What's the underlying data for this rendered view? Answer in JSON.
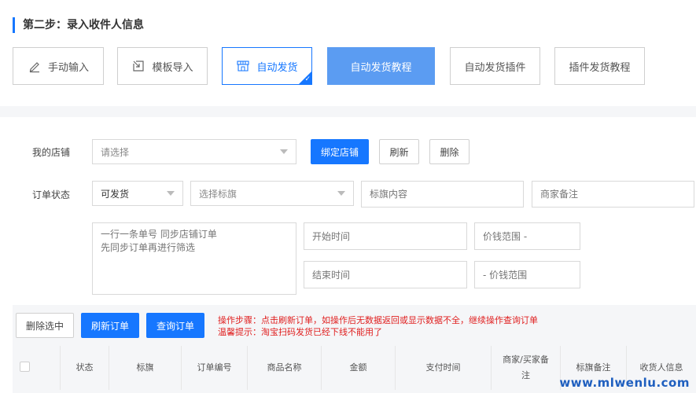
{
  "step": {
    "title": "第二步：录入收件人信息"
  },
  "methods": [
    {
      "label": "手动输入",
      "icon": "pencil-icon"
    },
    {
      "label": "模板导入",
      "icon": "import-icon"
    },
    {
      "label": "自动发货",
      "icon": "store-icon",
      "selected": true
    },
    {
      "label": "自动发货教程",
      "highlight": true
    },
    {
      "label": "自动发货插件"
    },
    {
      "label": "插件发货教程"
    }
  ],
  "shop": {
    "label": "我的店铺",
    "placeholder": "请选择",
    "bind_btn": "绑定店铺",
    "refresh_btn": "刷新",
    "delete_btn": "删除"
  },
  "order": {
    "label": "订单状态",
    "status_value": "可发货",
    "flag_placeholder": "选择标旗",
    "flag_content_placeholder": "标旗内容",
    "merchant_note_placeholder": "商家备注",
    "order_numbers_placeholder": "一行一条单号 同步店铺订单\n先同步订单再进行筛选",
    "start_time_placeholder": "开始时间",
    "end_time_placeholder": "结束时间",
    "price_min_placeholder": "价钱范围 -",
    "price_max_placeholder": "- 价钱范围"
  },
  "actions": {
    "delete_selected": "删除选中",
    "refresh_orders": "刷新订单",
    "query_orders": "查询订单",
    "tip_steps": "操作步骤：点击刷新订单，如操作后无数据返回或显示数据不全，继续操作查询订单",
    "tip_warm": "温馨提示：淘宝扫码发货已经下线不能用了"
  },
  "table": {
    "columns": [
      "状态",
      "标旗",
      "订单编号",
      "商品名称",
      "金额",
      "支付时间",
      "商家/买家备注",
      "标旗备注",
      "收货人信息"
    ]
  },
  "watermark": "www.mlwenlu.com",
  "colors": {
    "primary": "#1677ff",
    "highlight": "#5b9cf2",
    "danger": "#e02020"
  }
}
